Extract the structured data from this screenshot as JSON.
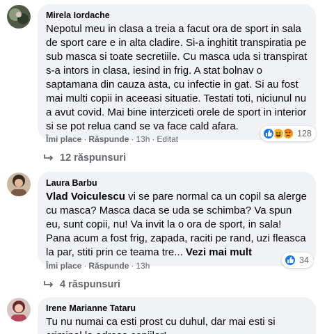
{
  "comments": [
    {
      "author": "Mirela Iordache",
      "text": "Nepotul meu in clasa a treia a facut ora de sport in sala de sport care e in alta cladire. Si-a inghitit transpiratia pe sub masca si toate secretiile. Cu masca uda si transpirat s-a intors in clasa, iesind in frig. A stat bolnav o saptamana din cauza asta, cu infectie in gat. Si au fost mai multi copii in aceeasi situatie. Testati toti, niciunul nu a avut covid. Mai bine interziceti orele de sport in interior si se pot relua cand se va face cald afara.",
      "like_label": "Îmi place",
      "reply_label": "Răspunde",
      "time": "13h",
      "edited": "Editat",
      "reaction_count": "128",
      "reaction_icons": [
        "like-icon",
        "haha-icon",
        "angry-icon"
      ],
      "replies_label": "12 răspunsuri"
    },
    {
      "author": "Laura Barbu",
      "mention": "Vlad Voiculescu",
      "text": " vi se pare normal ca un copil sa alerge cu masca? Masca daca se uda se schimba? Va spun eu, sunt copii, nu! Va invit la o ora de sport, in sala! Pana acum a fost frig, zapada, raciti pe rand, uzi fleasca la par, stiti prin ce teama tre... ",
      "see_more": "Vezi mai mult",
      "like_label": "Îmi place",
      "reply_label": "Răspunde",
      "time": "13h",
      "reaction_count": "34",
      "reaction_icons": [
        "like-icon"
      ],
      "replies_label": "4 răspunsuri"
    },
    {
      "author": "Irene Marianne Tataru",
      "text": "Tu nu numai ca esti prost cu duhul, dar mai esti si criminal la adresa copiilor!"
    }
  ],
  "colors": {
    "bubble": "#f0f2f5",
    "secondary_text": "#65676b",
    "like_blue": "#1877f2",
    "haha_yellow": "#f7b125",
    "angry_orange": "#e9710f"
  }
}
